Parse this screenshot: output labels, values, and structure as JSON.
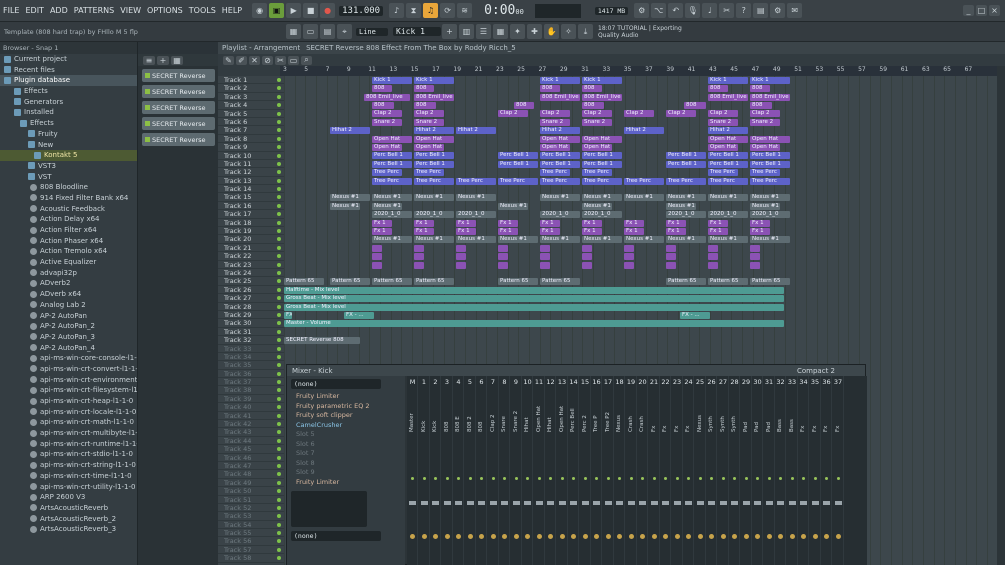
{
  "menu": [
    "FILE",
    "EDIT",
    "ADD",
    "PATTERNS",
    "VIEW",
    "OPTIONS",
    "TOOLS",
    "HELP"
  ],
  "transport": {
    "tempo": "131.000",
    "time": "0:00",
    "time_small": "00",
    "pattern_label": "Kick 1",
    "snap": "Line",
    "memory": "1417 MB",
    "cpu": "66",
    "cpu2": "0"
  },
  "hint": {
    "line1": "18:07 TUTORIAL | Exporting",
    "line2": "Quality Audio"
  },
  "template_title": "Template (808 hard trap) by FHllo M 5 flp",
  "browser": {
    "header": "Browser - Snap 1",
    "items": [
      {
        "label": "Current project",
        "type": "folder"
      },
      {
        "label": "Recent files",
        "type": "folder"
      },
      {
        "label": "Plugin database",
        "type": "folder",
        "sel": true
      },
      {
        "label": "Effects",
        "type": "folder"
      },
      {
        "label": "Generators",
        "type": "folder"
      },
      {
        "label": "Installed",
        "type": "folder"
      },
      {
        "label": "Effects",
        "type": "folder"
      },
      {
        "label": "Fruity",
        "type": "folder"
      },
      {
        "label": "New",
        "type": "folder"
      },
      {
        "label": "Kontakt 5",
        "type": "kontakt"
      },
      {
        "label": "VST3",
        "type": "folder"
      },
      {
        "label": "VST",
        "type": "folder"
      },
      {
        "label": "808 Bloodline",
        "type": "plugin"
      },
      {
        "label": "914 Fixed Filter Bank x64",
        "type": "plugin"
      },
      {
        "label": "Acoustic Feedback",
        "type": "plugin"
      },
      {
        "label": "Action Delay x64",
        "type": "plugin"
      },
      {
        "label": "Action Filter x64",
        "type": "plugin"
      },
      {
        "label": "Action Phaser x64",
        "type": "plugin"
      },
      {
        "label": "Action Tremolo x64",
        "type": "plugin"
      },
      {
        "label": "Active Equalizer",
        "type": "plugin"
      },
      {
        "label": "advapi32p",
        "type": "plugin"
      },
      {
        "label": "ADverb2",
        "type": "plugin"
      },
      {
        "label": "ADverb x64",
        "type": "plugin"
      },
      {
        "label": "Analog Lab 2",
        "type": "plugin"
      },
      {
        "label": "AP-2 AutoPan",
        "type": "plugin"
      },
      {
        "label": "AP-2 AutoPan_2",
        "type": "plugin"
      },
      {
        "label": "AP-2 AutoPan_3",
        "type": "plugin"
      },
      {
        "label": "AP-2 AutoPan_4",
        "type": "plugin"
      },
      {
        "label": "api-ms-win-core-console-l1-1-0",
        "type": "plugin"
      },
      {
        "label": "api-ms-win-crt-convert-l1-1-0",
        "type": "plugin"
      },
      {
        "label": "api-ms-win-crt-environment-l1-1-0",
        "type": "plugin"
      },
      {
        "label": "api-ms-win-crt-filesystem-l1-1-0",
        "type": "plugin"
      },
      {
        "label": "api-ms-win-crt-heap-l1-1-0",
        "type": "plugin"
      },
      {
        "label": "api-ms-win-crt-locale-l1-1-0",
        "type": "plugin"
      },
      {
        "label": "api-ms-win-crt-math-l1-1-0",
        "type": "plugin"
      },
      {
        "label": "api-ms-win-crt-multibyte-l1-1-0",
        "type": "plugin"
      },
      {
        "label": "api-ms-win-crt-runtime-l1-1-0",
        "type": "plugin"
      },
      {
        "label": "api-ms-win-crt-stdio-l1-1-0",
        "type": "plugin"
      },
      {
        "label": "api-ms-win-crt-string-l1-1-0",
        "type": "plugin"
      },
      {
        "label": "api-ms-win-crt-time-l1-1-0",
        "type": "plugin"
      },
      {
        "label": "api-ms-win-crt-utility-l1-1-0",
        "type": "plugin"
      },
      {
        "label": "ARP 2600 V3",
        "type": "plugin"
      },
      {
        "label": "ArtsAcousticReverb",
        "type": "plugin"
      },
      {
        "label": "ArtsAcousticReverb_2",
        "type": "plugin"
      },
      {
        "label": "ArtsAcousticReverb_3",
        "type": "plugin"
      }
    ]
  },
  "rack": {
    "label": "SECRET Reverse",
    "count": 5
  },
  "playlist": {
    "title": "Playlist - Arrangement",
    "pattern_title": "SECRET Reverse 808 Effect From The Box by Roddy Ricch_5",
    "ruler": [
      "3",
      "5",
      "7",
      "9",
      "11",
      "13",
      "15",
      "17",
      "19",
      "21",
      "23",
      "25",
      "27",
      "29",
      "31",
      "33",
      "35",
      "37",
      "39",
      "41",
      "43",
      "45",
      "47",
      "49",
      "51",
      "53",
      "55",
      "57",
      "59",
      "61",
      "63",
      "65",
      "67"
    ],
    "tracks": [
      "Track 1",
      "Track 2",
      "Track 3",
      "Track 4",
      "Track 5",
      "Track 6",
      "Track 7",
      "Track 8",
      "Track 9",
      "Track 10",
      "Track 11",
      "Track 12",
      "Track 13",
      "Track 14",
      "Track 15",
      "Track 16",
      "Track 17",
      "Track 18",
      "Track 19",
      "Track 20",
      "Track 21",
      "Track 22",
      "Track 23",
      "Track 24",
      "Track 25",
      "Track 26",
      "Track 27",
      "Track 28",
      "Track 29",
      "Track 30",
      "Track 31",
      "Track 32",
      "Track 33",
      "Track 34",
      "Track 35",
      "Track 36",
      "Track 37",
      "Track 38",
      "Track 39",
      "Track 40",
      "Track 41",
      "Track 42",
      "Track 43",
      "Track 44",
      "Track 45",
      "Track 46",
      "Track 47",
      "Track 48",
      "Track 49",
      "Track 50",
      "Track 51",
      "Track 52",
      "Track 53",
      "Track 54",
      "Track 55",
      "Track 56",
      "Track 57",
      "Track 58"
    ],
    "clip_names": [
      "Kick 1",
      "808",
      "808 Emil_live",
      "808",
      "Clap 2",
      "Snare 2",
      "Hihat 2",
      "Open Hat",
      "Open Hat",
      "Perc Bell 1",
      "Perc Bell 1",
      "Tree Perc",
      "Tree Perc",
      "",
      "Nexus #1",
      "Nexus #1",
      "2020_1_0",
      "Fx 1",
      "Fx 1",
      "Nexus #1",
      "",
      "",
      "",
      "",
      "Pattern 65",
      "Halftime - Mix level",
      "Gross Beat - Mix level",
      "Gross Beat - Mix level",
      "FX - ...",
      "Master - Volume",
      "",
      "SECRET Reverse 808"
    ]
  },
  "mixer": {
    "title": "Mixer - Kick",
    "preset": "(none)",
    "view": "Compact 2",
    "fx_slots": [
      {
        "label": "Fruity Limiter",
        "kind": "red"
      },
      {
        "label": "Fruity parametric EQ 2",
        "kind": "red"
      },
      {
        "label": "Fruity soft clipper",
        "kind": "red"
      },
      {
        "label": "CamelCrusher",
        "kind": "blue"
      },
      {
        "label": "Slot 5",
        "kind": "empty"
      },
      {
        "label": "Slot 6",
        "kind": "empty"
      },
      {
        "label": "Slot 7",
        "kind": "empty"
      },
      {
        "label": "Slot 8",
        "kind": "empty"
      },
      {
        "label": "Slot 9",
        "kind": "empty"
      },
      {
        "label": "Fruity Limiter",
        "kind": "red"
      }
    ],
    "bottom_preset": "(none)",
    "strips": [
      "M",
      "1",
      "2",
      "3",
      "4",
      "5",
      "6",
      "7",
      "8",
      "9",
      "10",
      "11",
      "12",
      "13",
      "14",
      "15",
      "16",
      "17",
      "18",
      "19",
      "20",
      "21",
      "22",
      "23",
      "24",
      "25",
      "26",
      "27",
      "28",
      "29",
      "30",
      "31",
      "32",
      "33",
      "34",
      "35",
      "36",
      "37"
    ],
    "strip_names": [
      "Master",
      "Kick",
      "Kick",
      "808",
      "808 E",
      "808 2",
      "808",
      "Clap 2",
      "Snare",
      "Snare 2",
      "Hihat",
      "Open Hat",
      "Hihat",
      "Open Hat",
      "Perc Bell",
      "Perc 2",
      "Tree P",
      "Tree P2",
      "Nexus",
      "Crash",
      "Crash",
      "Fx",
      "Fx",
      "Fx",
      "Fx",
      "Nexus",
      "Synth",
      "Synth",
      "Synth",
      "Pad",
      "Pad",
      "Pad",
      "Bass",
      "Bass",
      "Fx",
      "Fx",
      "Fx",
      "Fx"
    ]
  },
  "colors": {
    "accent": "#e9a63a",
    "clip_blue": "#5d62c9",
    "clip_purple": "#8b52b4",
    "led_green": "#7ec24a"
  }
}
